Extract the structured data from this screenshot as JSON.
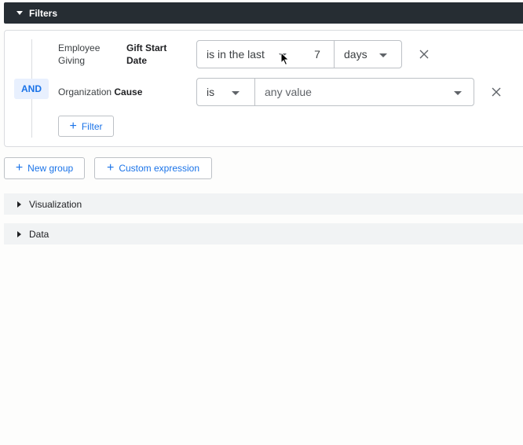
{
  "filters": {
    "header_label": "Filters",
    "logic_chip": "AND",
    "rows": [
      {
        "field_group": [
          "Employee",
          "Giving"
        ],
        "field_name": [
          "Gift Start",
          "Date"
        ],
        "operator": "is in the last",
        "value": "7",
        "unit": "days"
      },
      {
        "field_group": "Organization",
        "field_name": "Cause",
        "operator": "is",
        "value_placeholder": "any value"
      }
    ],
    "add_filter_label": "Filter"
  },
  "actions": {
    "new_group_label": "New group",
    "custom_expression_label": "Custom expression"
  },
  "sections": [
    {
      "label": "Visualization"
    },
    {
      "label": "Data"
    }
  ],
  "icons": {
    "remove": "close-icon",
    "add": "plus-icon",
    "expand": "caret-down-icon",
    "collapsed": "caret-right-icon",
    "cursor": "mouse-pointer-icon"
  }
}
